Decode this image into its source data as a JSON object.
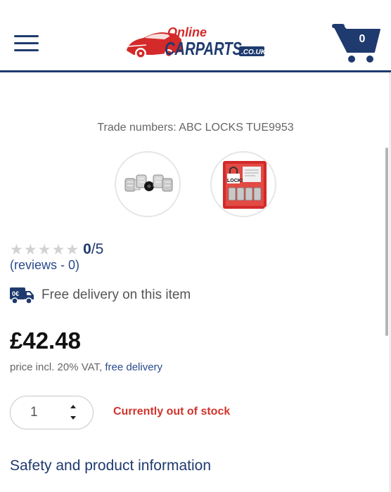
{
  "header": {
    "logo": {
      "word1": "Online",
      "word2": "CARPARTS",
      "suffix": ".CO.UK"
    },
    "cart_count": "0"
  },
  "product": {
    "trade_numbers": "Trade numbers: ABC LOCKS TUE9953",
    "thumbnails": [
      "wheel-lock-nuts-image",
      "locks-package-image"
    ],
    "package_label": "LOCKS",
    "rating": {
      "stars_filled": 0,
      "stars_total": 5,
      "score_value": "0",
      "score_max": "/5",
      "reviews_text": "(reviews - 0)"
    },
    "delivery": {
      "badge": "0€",
      "text": "Free delivery on this item"
    },
    "price": "£42.48",
    "vat_text": "price incl. 20% VAT,",
    "vat_link": "free delivery",
    "quantity": "1",
    "stock_status": "Currently out of stock",
    "safety_link": "Safety and product information"
  },
  "colors": {
    "brand_navy": "#1f3a6e",
    "link_blue": "#2a4a8c",
    "logo_red": "#d42a2a",
    "out_of_stock_red": "#d0342c"
  }
}
